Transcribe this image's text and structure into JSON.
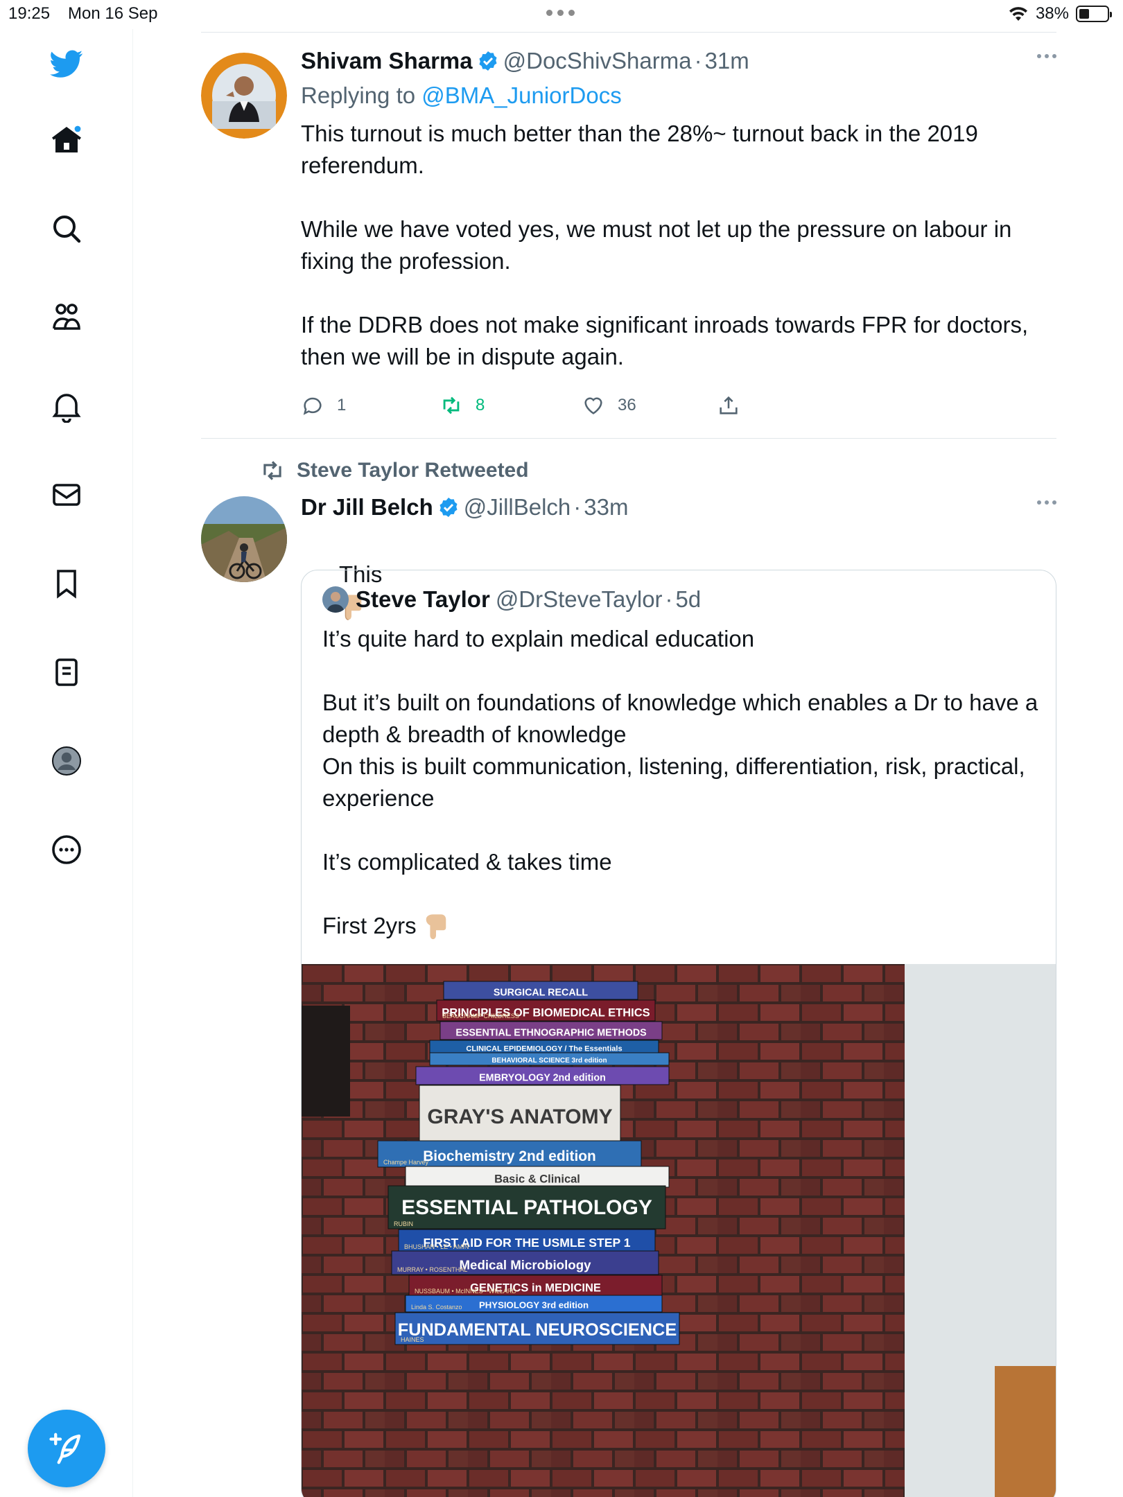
{
  "status_bar": {
    "time": "19:25",
    "date": "Mon 16 Sep",
    "battery": "38%"
  },
  "sidebar": {
    "items": [
      {
        "icon": "twitter-logo-icon"
      },
      {
        "icon": "home-icon"
      },
      {
        "icon": "search-icon"
      },
      {
        "icon": "communities-icon"
      },
      {
        "icon": "notifications-bell-icon"
      },
      {
        "icon": "messages-mail-icon"
      },
      {
        "icon": "bookmarks-icon"
      },
      {
        "icon": "lists-icon"
      },
      {
        "icon": "profile-avatar-icon"
      },
      {
        "icon": "more-circle-icon"
      }
    ],
    "compose_icon": "compose-feather-icon",
    "accent": "#1d9bf0"
  },
  "tweet1": {
    "name": "Shivam Sharma",
    "handle": "@DocShivSharma",
    "separator": "·",
    "time": "31m",
    "replying_prefix": "Replying to",
    "replying_to": "@BMA_JuniorDocs",
    "text": "This turnout is much better than the 28%~ turnout back in the 2019 referendum.\n\nWhile we have voted yes, we must not let up the pressure on labour in fixing the profession.\n\nIf the DDRB does not make significant inroads towards FPR for doctors, then we will be in dispute again.",
    "replies": "1",
    "retweets": "8",
    "likes": "36",
    "retweet_color": "#00ba7c"
  },
  "retweet_banner": {
    "text": "Steve Taylor Retweeted"
  },
  "tweet2": {
    "name": "Dr Jill Belch",
    "handle": "@JillBelch",
    "separator": "·",
    "time": "33m",
    "text": "This"
  },
  "quote": {
    "name": "Steve Taylor",
    "handle": "@DrSteveTaylor",
    "separator": "·",
    "time": "5d",
    "text": "It’s quite hard to explain medical education\n\nBut it’s built on foundations of knowledge which enables a Dr to have a depth & breadth of knowledge\nOn this is built communication, listening, differentiation, risk, practical, experience\n\nIt’s complicated & takes time\n\nFirst 2yrs",
    "books": [
      {
        "title": "SURGICAL RECALL",
        "color": "#3d4fa0"
      },
      {
        "title": "PRINCIPLES OF BIOMEDICAL ETHICS",
        "sub": "BEAUCHAMP CHILDRESS",
        "color": "#7a1c2b"
      },
      {
        "title": "ESSENTIAL ETHNOGRAPHIC METHODS",
        "color": "#7a3f87"
      },
      {
        "title": "CLINICAL EPIDEMIOLOGY / The Essentials",
        "color": "#1e5fa6"
      },
      {
        "title": "BEHAVIORAL SCIENCE 3rd edition",
        "color": "#3a7fc4"
      },
      {
        "title": "EMBRYOLOGY 2nd edition",
        "color": "#6d4bb0"
      },
      {
        "title": "GRAY'S ANATOMY",
        "color": "#e8e6e1"
      },
      {
        "title": "Biochemistry 2nd edition",
        "sub": "Champe Harvey",
        "color": "#2f6fb4"
      },
      {
        "title": "Basic & Clinical",
        "color": "#f1f1ef"
      },
      {
        "title": "ESSENTIAL PATHOLOGY",
        "sub": "RUBIN",
        "color": "#233a30"
      },
      {
        "title": "FIRST AID FOR THE USMLE STEP 1",
        "sub": "BHUSHAN • LE • AMIN",
        "color": "#1f4fa8"
      },
      {
        "title": "Medical Microbiology",
        "sub": "MURRAY • ROSENTHAL",
        "color": "#3b3f8f"
      },
      {
        "title": "GENETICS in MEDICINE",
        "sub": "NUSSBAUM • McINNES • WILLARD",
        "color": "#7b1d2c"
      },
      {
        "title": "PHYSIOLOGY 3rd edition",
        "sub": "Linda S. Costanzo",
        "color": "#2b6fd1"
      },
      {
        "title": "FUNDAMENTAL NEUROSCIENCE",
        "sub": "HAINES",
        "color": "#2f62b8"
      }
    ]
  }
}
